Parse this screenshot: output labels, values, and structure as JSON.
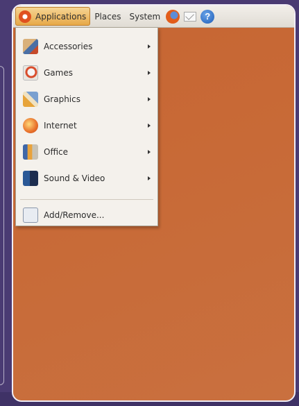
{
  "panel": {
    "applications_label": "Applications",
    "places_label": "Places",
    "system_label": "System",
    "help_glyph": "?"
  },
  "menu": {
    "items": [
      {
        "label": "Accessories",
        "icon": "accessories-icon"
      },
      {
        "label": "Games",
        "icon": "games-icon"
      },
      {
        "label": "Graphics",
        "icon": "graphics-icon"
      },
      {
        "label": "Internet",
        "icon": "internet-icon"
      },
      {
        "label": "Office",
        "icon": "office-icon"
      },
      {
        "label": "Sound & Video",
        "icon": "sound-video-icon"
      }
    ],
    "add_remove_label": "Add/Remove..."
  },
  "colors": {
    "desktop": "#c86a37",
    "panel": "#e9e5dd",
    "menu_bg": "#f4f1ec",
    "active_highlight": "#eeb763",
    "frame": "#4a3b73"
  }
}
